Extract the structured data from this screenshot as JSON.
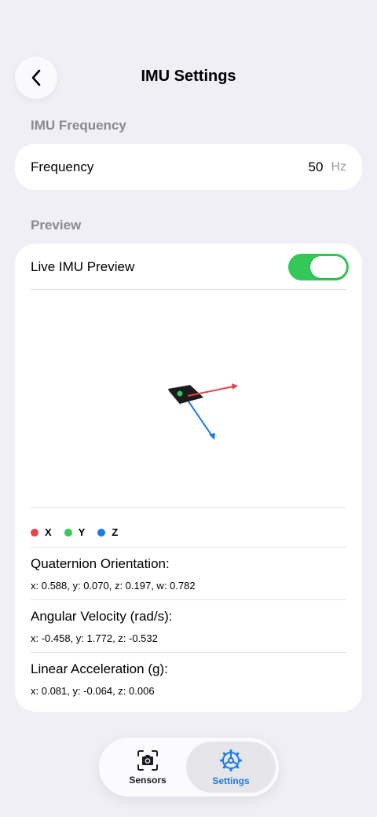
{
  "header": {
    "title": "IMU Settings"
  },
  "frequency_section": {
    "header": "IMU Frequency",
    "label": "Frequency",
    "value": "50",
    "unit": "Hz"
  },
  "preview_section": {
    "header": "Preview",
    "toggle_label": "Live IMU Preview",
    "toggle_on": true,
    "legend": [
      {
        "label": "X",
        "color": "#e8424b"
      },
      {
        "label": "Y",
        "color": "#34c759"
      },
      {
        "label": "Z",
        "color": "#1a7be5"
      }
    ],
    "metrics": [
      {
        "title": "Quaternion Orientation:",
        "value": "x: 0.588, y: 0.070, z: 0.197, w: 0.782"
      },
      {
        "title": "Angular Velocity (rad/s):",
        "value": "x: -0.458, y: 1.772, z: -0.532"
      },
      {
        "title": "Linear Acceleration (g):",
        "value": "x: 0.081, y: -0.064, z: 0.006"
      }
    ]
  },
  "tabbar": {
    "sensors_label": "Sensors",
    "settings_label": "Settings",
    "active": "Settings"
  },
  "colors": {
    "accent": "#1a7be5",
    "toggle_on": "#34c759",
    "background": "#f0eff5"
  }
}
